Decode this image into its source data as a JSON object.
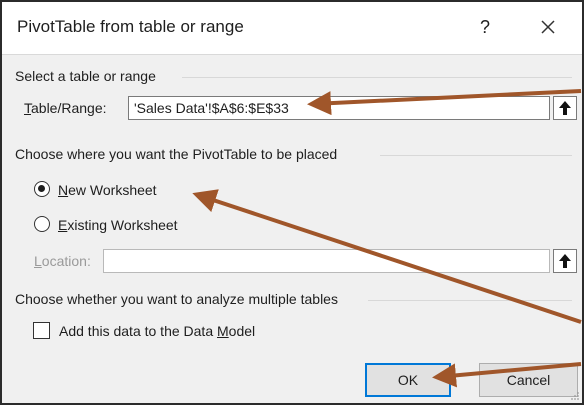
{
  "dialog": {
    "title": "PivotTable from table or range",
    "help_label": "?",
    "close_label": "Close"
  },
  "select_range": {
    "section_label": "Select a table or range",
    "field_label_prefix": "",
    "field_label_underlined": "T",
    "field_label_rest": "able/Range:",
    "value": "'Sales Data'!$A$6:$E$33"
  },
  "placement": {
    "section_label": "Choose where you want the PivotTable to be placed",
    "new_worksheet": {
      "u": "N",
      "rest": "ew Worksheet",
      "selected": true
    },
    "existing_worksheet": {
      "u": "E",
      "rest": "xisting Worksheet",
      "selected": false
    },
    "location": {
      "u": "L",
      "rest": "ocation:",
      "value": ""
    }
  },
  "multiple_tables": {
    "section_label": "Choose whether you want to analyze multiple tables",
    "checkbox": {
      "prefix": "Add this data to the Data ",
      "u": "M",
      "rest": "odel",
      "checked": false
    }
  },
  "buttons": {
    "ok_label": "OK",
    "cancel_label": "Cancel"
  },
  "colors": {
    "annotation_arrow": "#a0562a",
    "default_button_border": "#0078d7"
  }
}
